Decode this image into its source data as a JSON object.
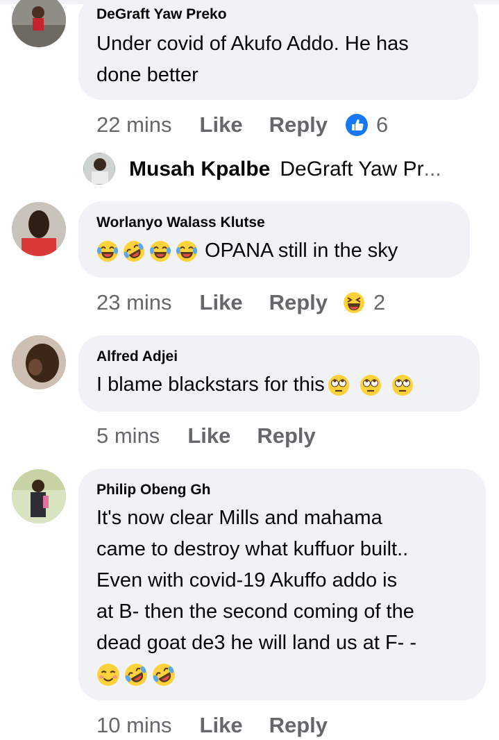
{
  "comments": [
    {
      "author": "DeGraft Yaw Preko",
      "text_lines": [
        "Under covid of Akufo Addo. He has",
        "done better"
      ],
      "time": "22 mins",
      "like_label": "Like",
      "reply_label": "Reply",
      "reaction": {
        "icon": "thumbs-up-reaction-icon",
        "count": "6"
      }
    },
    {
      "author": "Worlanyo Walass Klutse",
      "text": "OPANA still in the sky",
      "emojis": [
        "crying-laughing",
        "rolling-laughing",
        "crying-laughing",
        "crying-laughing"
      ],
      "time": "23 mins",
      "like_label": "Like",
      "reply_label": "Reply",
      "reaction": {
        "icon": "haha-reaction-icon",
        "count": "2"
      }
    },
    {
      "author": "Alfred Adjei",
      "text": "I blame blackstars for this",
      "emojis": [
        "eye-roll",
        "eye-roll",
        "eye-roll"
      ],
      "time": "5 mins",
      "like_label": "Like",
      "reply_label": "Reply"
    },
    {
      "author": "Philip Obeng Gh",
      "text_lines": [
        "It's now clear Mills and mahama",
        "came to destroy what kuffuor built..",
        "Even with covid-19 Akuffo addo is",
        "at B- then the second coming of the",
        "dead goat de3 he will land us at F- -"
      ],
      "emojis": [
        "smiling-blush",
        "rolling-laughing",
        "rolling-laughing"
      ],
      "time": "10 mins",
      "like_label": "Like",
      "reply_label": "Reply"
    }
  ],
  "reply_preview": {
    "author": "Musah Kpalbe",
    "text": "DeGraft Yaw Pr",
    "ellipsis": "..."
  },
  "colors": {
    "bubble": "#f0f2f5",
    "meta_text": "#65676b",
    "like_blue": "#1877f2",
    "emoji_yellow": "#fdd23b"
  }
}
